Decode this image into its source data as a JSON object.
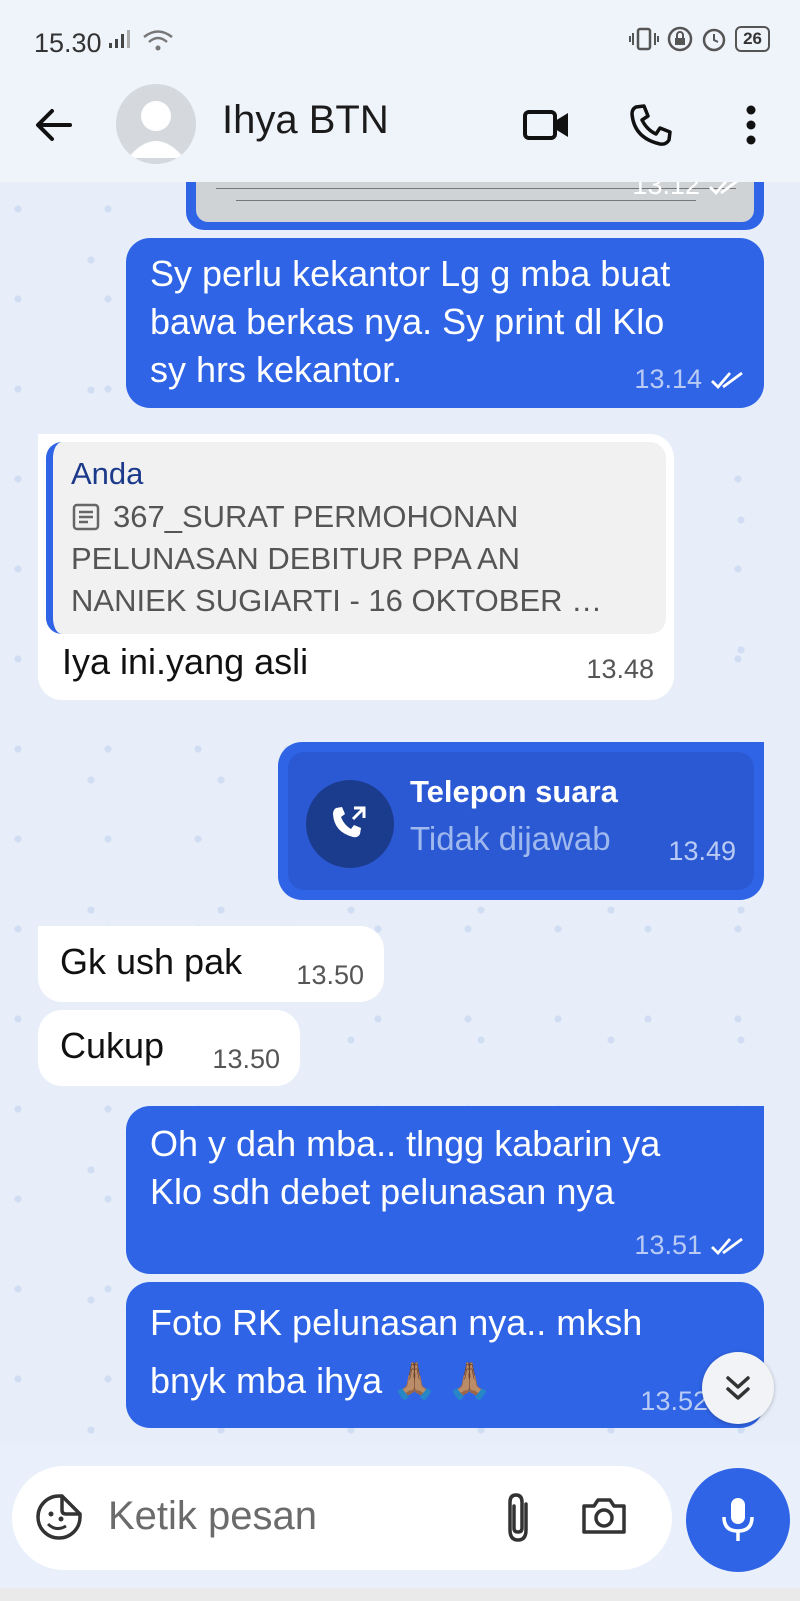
{
  "status": {
    "time": "15.30",
    "battery": "26"
  },
  "header": {
    "contact_name": "Ihya BTN"
  },
  "messages": [
    {
      "dir": "out",
      "time": "13.12"
    },
    {
      "dir": "out",
      "text": "Sy perlu kekantor Lg g mba buat bawa berkas nya. Sy print dl Klo sy hrs kekantor.",
      "line1": "Sy perlu kekantor Lg g mba buat",
      "line2": "bawa berkas nya. Sy print dl Klo",
      "line3": "sy hrs kekantor.",
      "time": "13.14"
    },
    {
      "dir": "in",
      "quote_author": "Anda",
      "quote_line1": "367_SURAT PERMOHONAN",
      "quote_line2": "PELUNASAN DEBITUR PPA AN",
      "quote_line3": "NANIEK SUGIARTI - 16 OKTOBER …",
      "text": "Iya ini.yang asli",
      "time": "13.48"
    },
    {
      "dir": "out",
      "call_title": "Telepon suara",
      "call_status": "Tidak dijawab",
      "time": "13.49"
    },
    {
      "dir": "in",
      "text": "Gk ush pak",
      "time": "13.50"
    },
    {
      "dir": "in",
      "text": "Cukup",
      "time": "13.50"
    },
    {
      "dir": "out",
      "line1": "Oh y dah mba.. tlngg kabarin ya",
      "line2": "Klo sdh debet pelunasan nya",
      "time": "13.51"
    },
    {
      "dir": "out",
      "line1": "Foto RK pelunasan nya.. mksh",
      "line2": "bnyk mba ihya 🙏🏽 🙏🏽",
      "time": "13.52"
    }
  ],
  "input": {
    "placeholder": "Ketik pesan"
  },
  "icons": {
    "back": "arrow-left-icon",
    "video": "video-camera-icon",
    "phone": "phone-icon",
    "more": "more-vert-icon",
    "sticker": "sticker-icon",
    "attach": "paperclip-icon",
    "camera": "camera-icon",
    "mic": "microphone-icon",
    "scroll": "double-chevron-down-icon",
    "read": "double-check-icon",
    "missed_call": "missed-outgoing-call-icon"
  },
  "colors": {
    "accent": "#2f64e6",
    "incoming": "#ffffff",
    "background": "#e7eefa"
  }
}
